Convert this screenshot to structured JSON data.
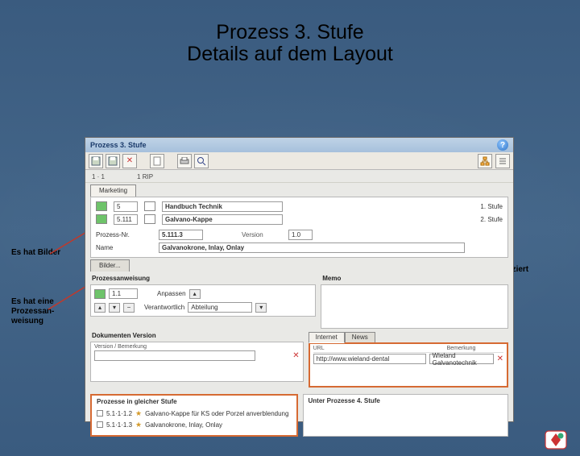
{
  "slide": {
    "title": "Prozess 3. Stufe",
    "subtitle": "Details auf dem Layout"
  },
  "annotations": {
    "bilder": "Es hat Bilder",
    "pa": "Es hat eine Prozessan-weisung",
    "news": "News werden publiziert"
  },
  "app": {
    "window_title": "Prozess 3. Stufe",
    "meta": {
      "left": "1 · 1",
      "right": "1 RIP"
    },
    "tabs": [
      "Marketing",
      "Bilder..."
    ],
    "breadcrumb": [
      {
        "nr": "5",
        "name": "Handbuch Technik",
        "stage": "1. Stufe"
      },
      {
        "nr": "5.111",
        "name": "Galvano-Kappe",
        "stage": "2. Stufe"
      }
    ],
    "form": {
      "prozess_nr_label": "Prozess-Nr.",
      "prozess_nr": "5.111.3",
      "name_label": "Name",
      "name": "Galvanokrone, Inlay, Onlay",
      "version_label": "Version",
      "version": "1.0"
    },
    "pa": {
      "title": "Prozessanweisung",
      "val": "1.1",
      "anpassen_label": "Anpassen",
      "verantwortlich_label": "Verantwortlich",
      "verantwortlich": "Abteilung"
    },
    "memo_label": "Memo",
    "dv": {
      "title": "Dokumenten Version",
      "col": "Version / Bemerkung"
    },
    "internet": {
      "tabs": [
        "Internet",
        "News"
      ],
      "url_label": "URL",
      "url": "http://www.wieland-dental",
      "bem_label": "Bemerkung",
      "bem": "Wieland Galvanotechnik"
    },
    "bottom": {
      "left_title": "Prozesse in gleicher Stufe",
      "p1_nr": "5.1·1·1.2",
      "p1_name": "Galvano-Kappe für KS oder Porzel anverblendung",
      "p2_nr": "5.1·1·1.3",
      "p2_name": "Galvanokrone, Inlay, Onlay",
      "right_title": "Unter Prozesse 4. Stufe"
    }
  }
}
